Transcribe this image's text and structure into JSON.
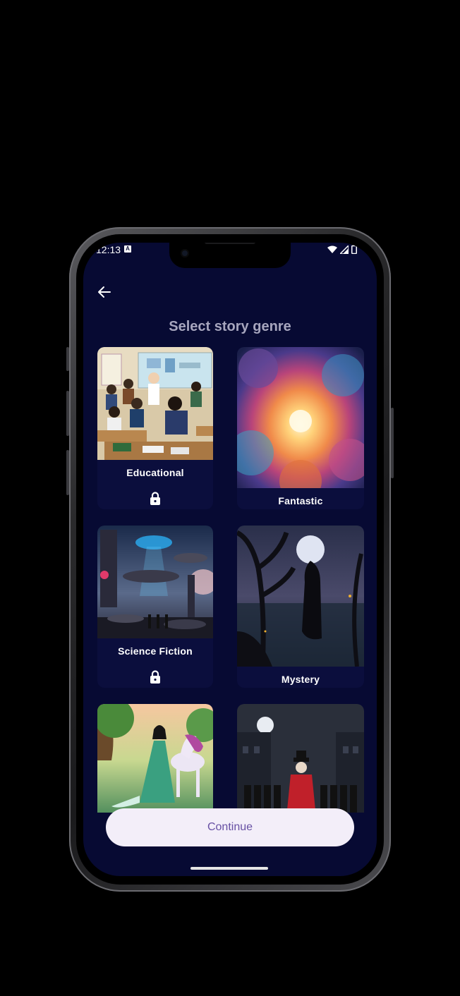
{
  "status": {
    "time": "12:13",
    "notification_badge": "A"
  },
  "header": {
    "back_icon": "arrow-left-icon",
    "title": "Select story genre"
  },
  "genres": [
    {
      "label": "Educational",
      "locked": true
    },
    {
      "label": "Fantastic",
      "locked": false
    },
    {
      "label": "Science Fiction",
      "locked": true
    },
    {
      "label": "Mystery",
      "locked": false
    },
    {
      "label": "",
      "locked": false
    },
    {
      "label": "",
      "locked": false
    }
  ],
  "continue_label": "Continue",
  "colors": {
    "background": "#070a33",
    "card": "#0b0e3d",
    "button": "#f3eef9",
    "button_text": "#6750a4",
    "title": "#a7a6be"
  }
}
